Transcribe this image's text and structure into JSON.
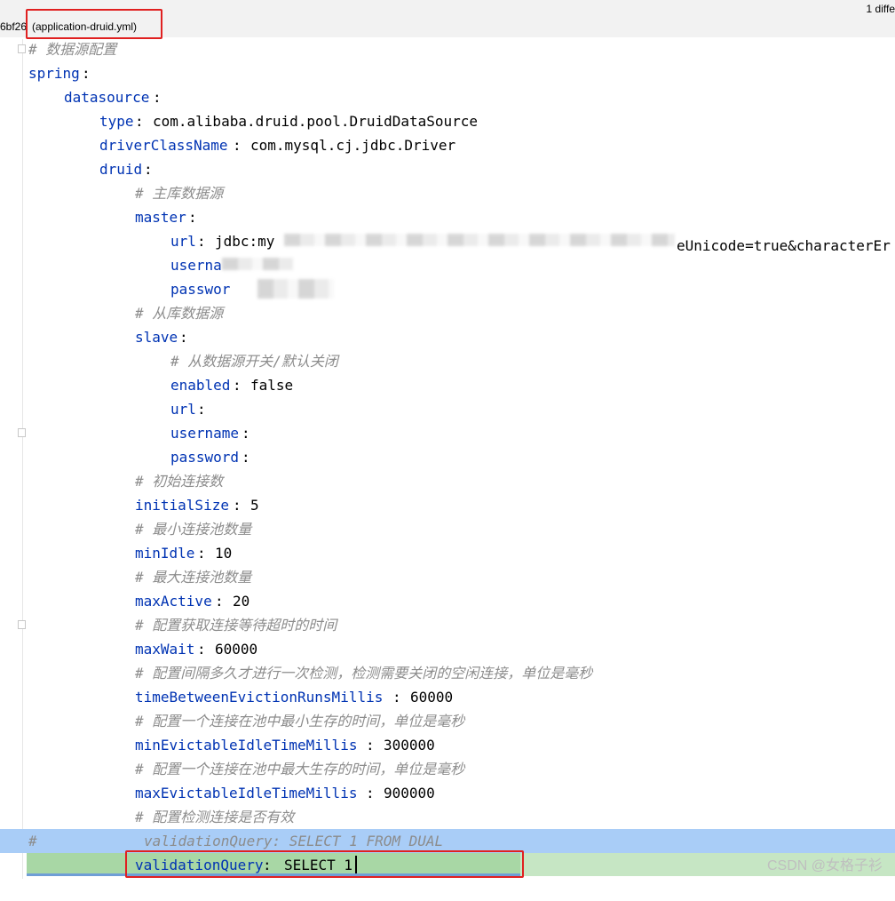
{
  "tab": {
    "hash": "6bf26",
    "file": "(application-druid.yml)",
    "diff_label": "1 diffe"
  },
  "lines": [
    {
      "key": "# 数据源配置",
      "sep": "",
      "val": "",
      "cls": "c",
      "indent": 0
    },
    {
      "key": "spring",
      "sep": ":",
      "val": "",
      "cls": "k",
      "indent": 0
    },
    {
      "key": "datasource",
      "sep": ":",
      "val": "",
      "cls": "k",
      "indent": 1
    },
    {
      "key": "type",
      "sep": ": ",
      "val": "com.alibaba.druid.pool.DruidDataSource",
      "cls": "k",
      "indent": 2
    },
    {
      "key": "driverClassName",
      "sep": ": ",
      "val": "com.mysql.cj.jdbc.Driver",
      "cls": "k",
      "indent": 2
    },
    {
      "key": "druid",
      "sep": ":",
      "val": "",
      "cls": "k",
      "indent": 2
    },
    {
      "key": "# 主库数据源",
      "sep": "",
      "val": "",
      "cls": "c",
      "indent": 3
    },
    {
      "key": "master",
      "sep": ":",
      "val": "",
      "cls": "k",
      "indent": 3
    },
    {
      "key": "url",
      "sep": ": ",
      "val": "jdbc:my",
      "cls": "k",
      "indent": 4
    },
    {
      "key": "userna",
      "sep": "",
      "val": "",
      "cls": "k",
      "indent": 4
    },
    {
      "key": "passwor",
      "sep": "",
      "val": "",
      "cls": "k",
      "indent": 4
    },
    {
      "key": "# 从库数据源",
      "sep": "",
      "val": "",
      "cls": "c",
      "indent": 3
    },
    {
      "key": "slave",
      "sep": ":",
      "val": "",
      "cls": "k",
      "indent": 3
    },
    {
      "key": "# 从数据源开关/默认关闭",
      "sep": "",
      "val": "",
      "cls": "c",
      "indent": 4
    },
    {
      "key": "enabled",
      "sep": ": ",
      "val": "false",
      "cls": "k",
      "indent": 4
    },
    {
      "key": "url",
      "sep": ":",
      "val": "",
      "cls": "k",
      "indent": 4
    },
    {
      "key": "username",
      "sep": ":",
      "val": "",
      "cls": "k",
      "indent": 4
    },
    {
      "key": "password",
      "sep": ":",
      "val": "",
      "cls": "k",
      "indent": 4
    },
    {
      "key": "# 初始连接数",
      "sep": "",
      "val": "",
      "cls": "c",
      "indent": 3
    },
    {
      "key": "initialSize",
      "sep": ": ",
      "val": "5",
      "cls": "k",
      "indent": 3
    },
    {
      "key": "# 最小连接池数量",
      "sep": "",
      "val": "",
      "cls": "c",
      "indent": 3
    },
    {
      "key": "minIdle",
      "sep": ": ",
      "val": "10",
      "cls": "k",
      "indent": 3
    },
    {
      "key": "# 最大连接池数量",
      "sep": "",
      "val": "",
      "cls": "c",
      "indent": 3
    },
    {
      "key": "maxActive",
      "sep": ": ",
      "val": "20",
      "cls": "k",
      "indent": 3
    },
    {
      "key": "# 配置获取连接等待超时的时间",
      "sep": "",
      "val": "",
      "cls": "c",
      "indent": 3
    },
    {
      "key": "maxWait",
      "sep": ": ",
      "val": "60000",
      "cls": "k",
      "indent": 3
    },
    {
      "key": "# 配置间隔多久才进行一次检测，检测需要关闭的空闲连接，单位是毫秒",
      "sep": "",
      "val": "",
      "cls": "c",
      "indent": 3
    },
    {
      "key": "timeBetweenEvictionRunsMillis",
      "sep": ": ",
      "val": "60000",
      "cls": "k",
      "indent": 3
    },
    {
      "key": "# 配置一个连接在池中最小生存的时间，单位是毫秒",
      "sep": "",
      "val": "",
      "cls": "c",
      "indent": 3
    },
    {
      "key": "minEvictableIdleTimeMillis",
      "sep": ": ",
      "val": "300000",
      "cls": "k",
      "indent": 3
    },
    {
      "key": "# 配置一个连接在池中最大生存的时间，单位是毫秒",
      "sep": "",
      "val": "",
      "cls": "c",
      "indent": 3
    },
    {
      "key": "maxEvictableIdleTimeMillis",
      "sep": ": ",
      "val": "900000",
      "cls": "k",
      "indent": 3
    },
    {
      "key": "# 配置检测连接是否有效",
      "sep": "",
      "val": "",
      "cls": "c",
      "indent": 3
    }
  ],
  "url_tail": "eUnicode=true&characterEr",
  "removed_line": {
    "hash": "#",
    "text": "validationQuery: SELECT 1 FROM DUAL"
  },
  "added_line": {
    "key": "validationQuery",
    "sep": ": ",
    "val": "SELECT 1"
  },
  "watermark": "CSDN @女格子衫"
}
